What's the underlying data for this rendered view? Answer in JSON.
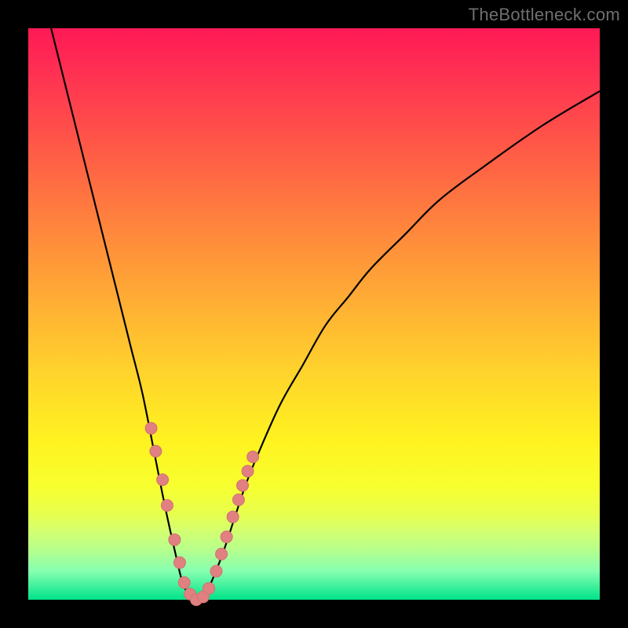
{
  "watermark": "TheBottleneck.com",
  "colors": {
    "frame": "#000000",
    "curve": "#000000",
    "marker_fill": "#e18080",
    "marker_stroke": "#d07272"
  },
  "chart_data": {
    "type": "line",
    "title": "",
    "xlabel": "",
    "ylabel": "",
    "xlim": [
      0,
      100
    ],
    "ylim": [
      0,
      100
    ],
    "grid": false,
    "legend": false,
    "annotations": [
      "TheBottleneck.com"
    ],
    "series": [
      {
        "name": "bottleneck-curve",
        "x": [
          4,
          6,
          8,
          10,
          12,
          14,
          16,
          18,
          20,
          22,
          24,
          26,
          27,
          28,
          29,
          30,
          31,
          32,
          34,
          36,
          38,
          40,
          44,
          48,
          52,
          56,
          60,
          66,
          72,
          80,
          90,
          100
        ],
        "y": [
          100,
          92,
          84,
          76,
          68,
          60,
          52,
          44,
          36,
          26,
          16,
          7,
          3,
          1,
          0,
          0,
          1,
          3,
          8,
          14,
          20,
          25,
          34,
          41,
          48,
          53,
          58,
          64,
          70,
          76,
          83,
          89
        ],
        "note": "Values estimated from pixel positions; minimum (0% bottleneck) near x≈29–30."
      }
    ],
    "markers": {
      "name": "highlight-dots",
      "x": [
        21.5,
        22.3,
        23.5,
        24.3,
        25.6,
        26.5,
        27.3,
        28.3,
        29.4,
        30.6,
        31.6,
        32.9,
        33.8,
        34.7,
        35.8,
        36.8,
        37.5,
        38.4,
        39.3
      ],
      "y": [
        30,
        26,
        21,
        16.5,
        10.5,
        6.5,
        3,
        1,
        0,
        0.5,
        2,
        5,
        8,
        11,
        14.5,
        17.5,
        20,
        22.5,
        25
      ],
      "size": 15
    }
  }
}
